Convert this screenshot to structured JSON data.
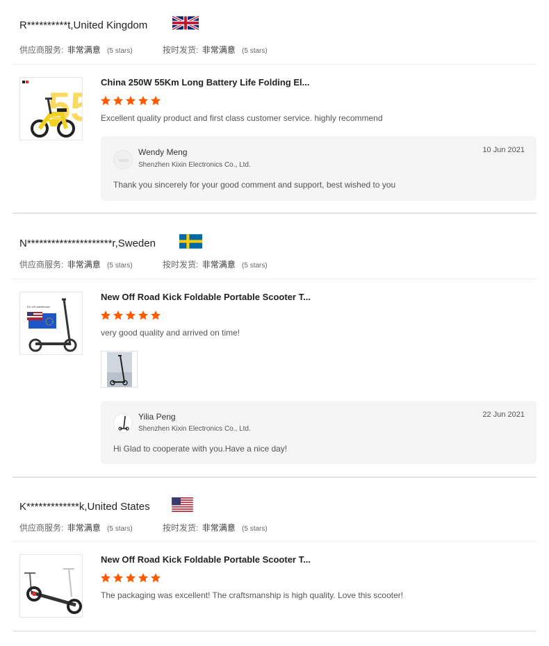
{
  "labels": {
    "supplier_service": "供应商服务:",
    "on_time_shipping": "按时发货:"
  },
  "colors": {
    "star": "#ff5a00",
    "accent": "#ff5a00"
  },
  "reviews": [
    {
      "buyer": "R**********t,United Kingdom",
      "country_flag_icon": "uk-flag-icon",
      "supplier_service_value": "非常满意",
      "supplier_service_stars": "(5 stars)",
      "on_time_shipping_value": "非常满意",
      "on_time_shipping_stars": "(5 stars)",
      "product_title": "China 250W 55Km Long Battery Life Folding El...",
      "rating": 5,
      "comment": "Excellent quality product and first class customer service. highly recommend",
      "reply": {
        "name": "Wendy Meng",
        "company": "Shenzhen Kixin Electronics Co., Ltd.",
        "date": "10 Jun 2021",
        "text": "Thank you sincerely for your good comment and support, best wished to you"
      }
    },
    {
      "buyer": "N*********************r,Sweden",
      "country_flag_icon": "sweden-flag-icon",
      "supplier_service_value": "非常满意",
      "supplier_service_stars": "(5 stars)",
      "on_time_shipping_value": "非常满意",
      "on_time_shipping_stars": "(5 stars)",
      "product_title": "New Off Road Kick Foldable Portable Scooter T...",
      "rating": 5,
      "comment": "very good quality and arrived on time!",
      "thumb_caption": "EU US warehouse",
      "reply": {
        "name": "Yilia Peng",
        "company": "Shenzhen Kixin Electronics Co., Ltd.",
        "date": "22 Jun 2021",
        "text": "Hi Glad to cooperate with you.Have a nice day!"
      }
    },
    {
      "buyer": "K*************k,United States",
      "country_flag_icon": "usa-flag-icon",
      "supplier_service_value": "非常满意",
      "supplier_service_stars": "(5 stars)",
      "on_time_shipping_value": "非常满意",
      "on_time_shipping_stars": "(5 stars)",
      "product_title": "New Off Road Kick Foldable Portable Scooter T...",
      "rating": 5,
      "comment": "The packaging was excellent! The craftsmanship is high quality. Love this scooter!"
    }
  ]
}
